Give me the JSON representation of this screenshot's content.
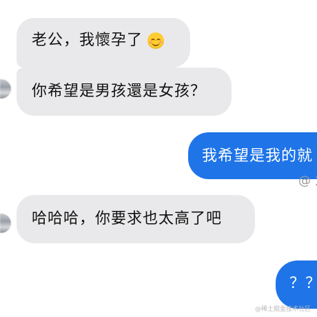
{
  "messages": [
    {
      "side": "incoming",
      "text": "老公，我懷孕了",
      "emoji": "smiling-face-emoji"
    },
    {
      "side": "incoming",
      "text": "你希望是男孩還是女孩？"
    },
    {
      "side": "outgoing",
      "text": "我希望是我的就"
    },
    {
      "side": "incoming",
      "text": "哈哈哈，你要求也太高了吧"
    },
    {
      "side": "outgoing",
      "text": "？？"
    }
  ],
  "overlay": {
    "clipped_label": "@ 力",
    "watermark": "@稀土掘金技术社区"
  },
  "colors": {
    "incoming_bubble": "#e9e9eb",
    "outgoing_bubble": "#1f74e8",
    "incoming_text": "#111111",
    "outgoing_text": "#ffffff"
  }
}
